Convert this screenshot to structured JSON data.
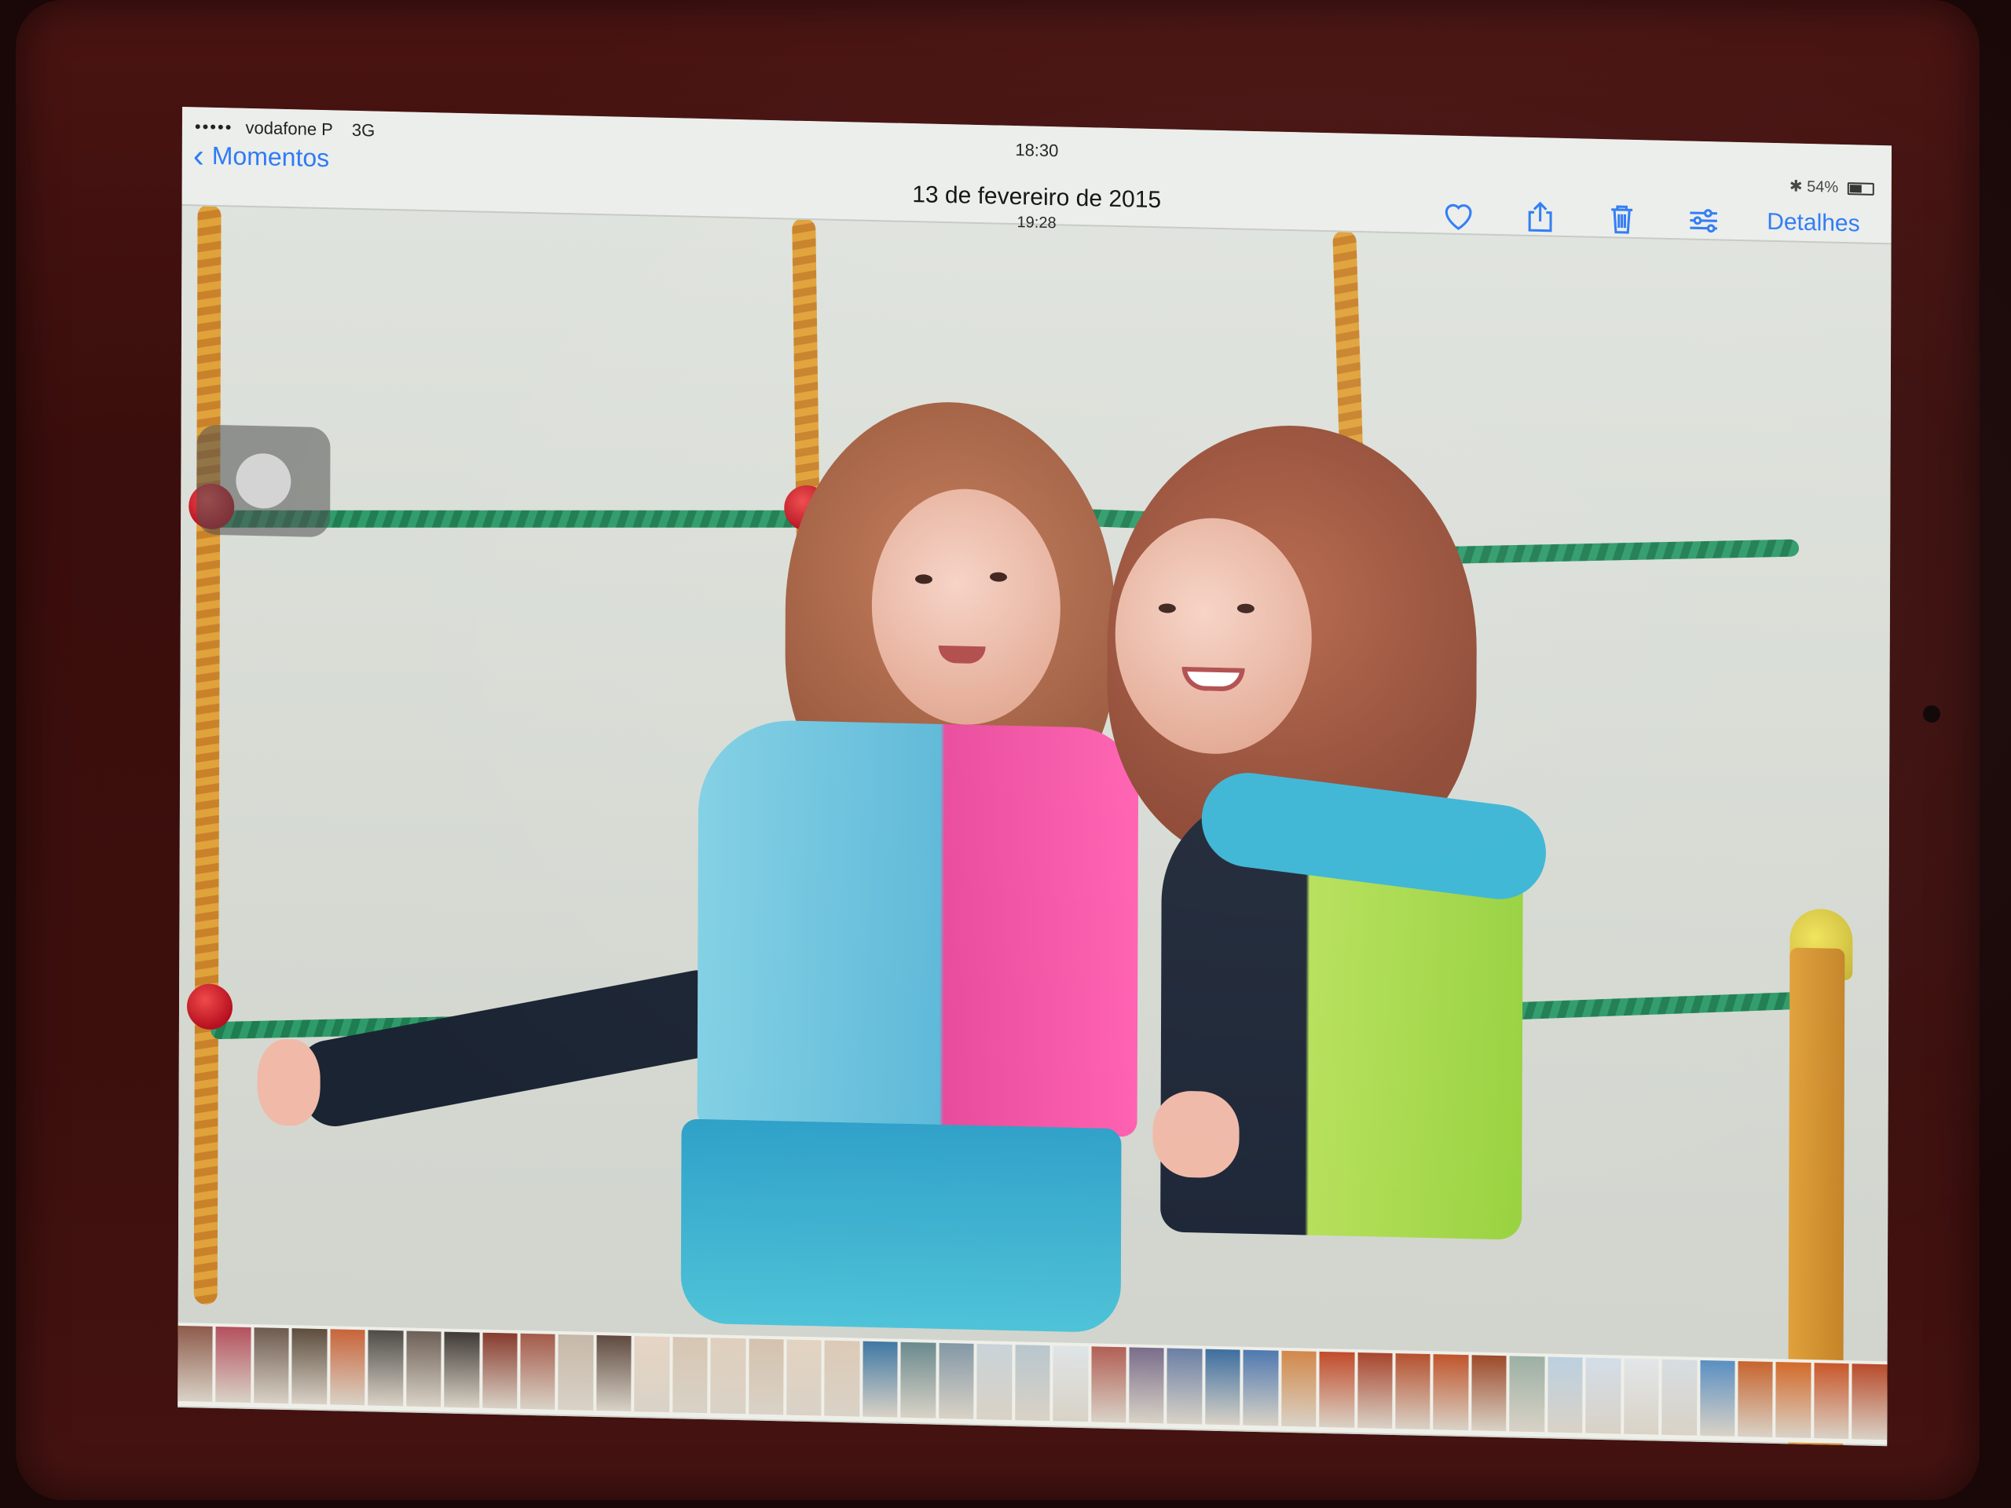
{
  "status_bar": {
    "signal_dots": "•••••",
    "carrier": "vodafone P",
    "network": "3G",
    "time": "18:30",
    "battery": "54%"
  },
  "nav": {
    "back_label": "Momentos",
    "title": "13 de fevereiro de 2015",
    "subtitle": "19:28",
    "details_label": "Detalhes"
  },
  "toolbar_icons": [
    "heart-icon",
    "share-icon",
    "trash-icon",
    "adjust-icon"
  ],
  "colors": {
    "accent": "#2f7bf5",
    "rope": "#d8952f",
    "net": "#2a8c5f",
    "knot": "#c81e2a"
  },
  "filmstrip": {
    "thumb_colors": [
      "#8e5b4b",
      "#b4505e",
      "#6e5a4f",
      "#5d4d3e",
      "#c8643a",
      "#4e4b48",
      "#6d5f57",
      "#403a36",
      "#873b2d",
      "#a45a4a",
      "#c6b8a8",
      "#5e4a40",
      "#e6d5c4",
      "#d7c6b2",
      "#e0cfbd",
      "#d5c2ae",
      "#e3d3c1",
      "#dccab6",
      "#3f78a4",
      "#6a8a8e",
      "#8398a6",
      "#c9d3d8",
      "#b8c6cd",
      "#dfe4e6",
      "#b25f55",
      "#7a6d8c",
      "#6a7fa6",
      "#3d6ea0",
      "#4f79b0",
      "#d2884a",
      "#c24b2a",
      "#a8452d",
      "#b5512f",
      "#c0552c",
      "#9d4a2a",
      "#9cb0a4",
      "#bcd0e0",
      "#d3dde8",
      "#e2e6e8",
      "#d7dde2",
      "#5a8fc2",
      "#c7642e",
      "#d36a2b",
      "#c9572a",
      "#b94b2b"
    ]
  }
}
